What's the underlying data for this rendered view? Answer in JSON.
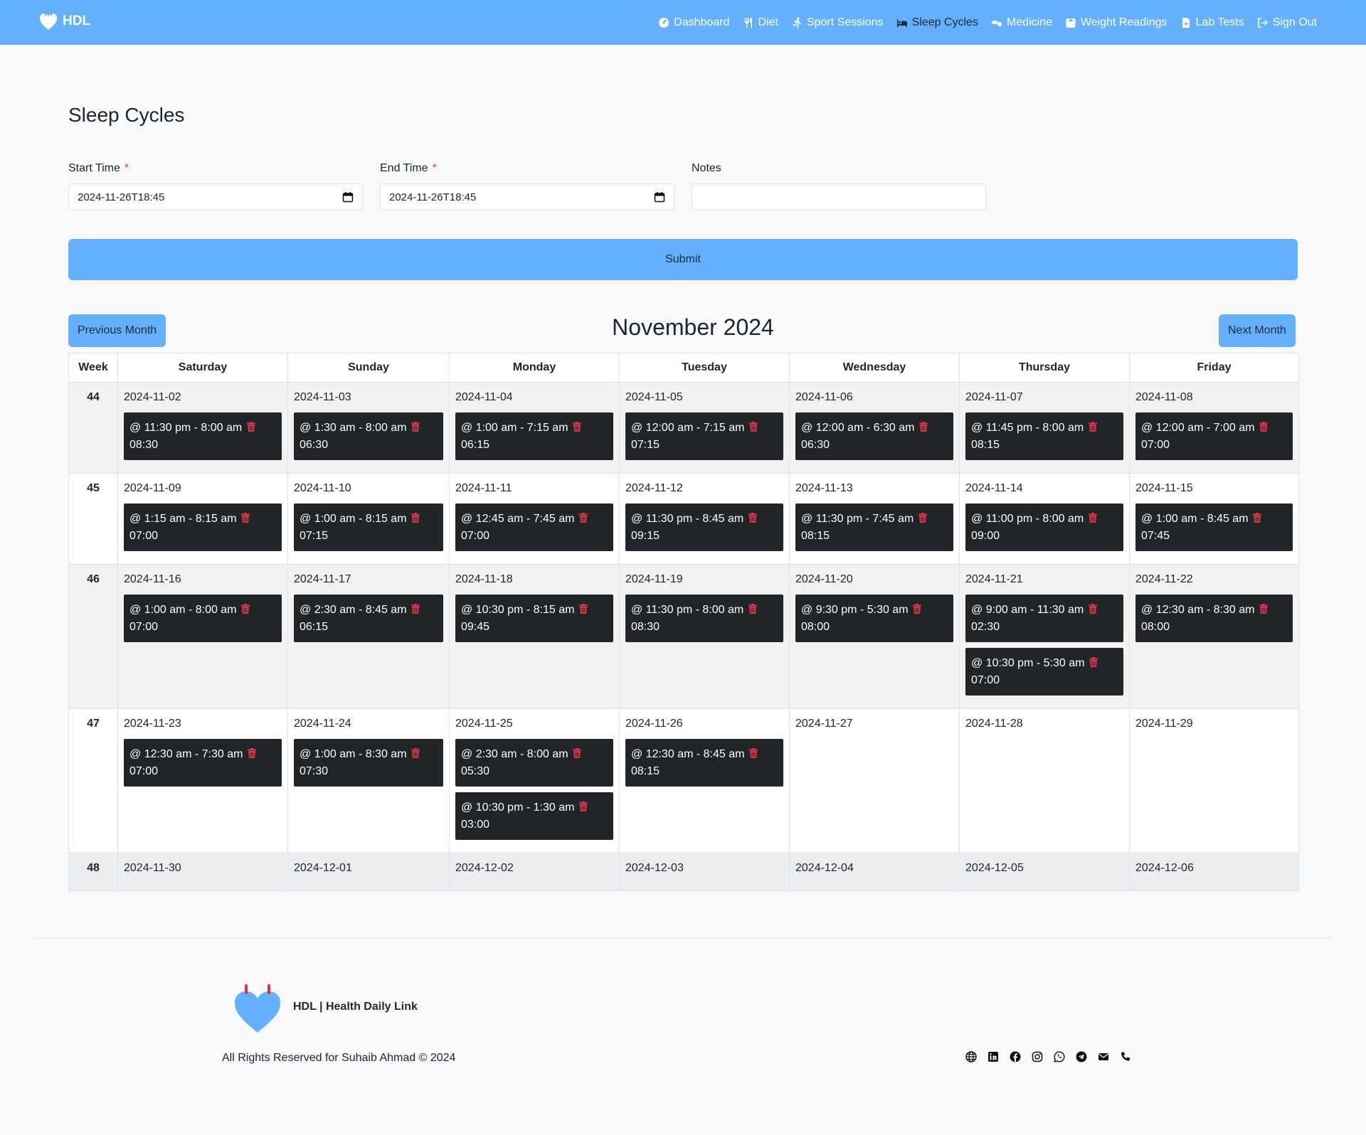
{
  "brand": {
    "name": "HDL"
  },
  "nav": [
    {
      "label": "Dashboard",
      "icon": "dashboard-icon",
      "active": false
    },
    {
      "label": "Diet",
      "icon": "utensils-icon",
      "active": false
    },
    {
      "label": "Sport Sessions",
      "icon": "running-icon",
      "active": false
    },
    {
      "label": "Sleep Cycles",
      "icon": "bed-icon",
      "active": true
    },
    {
      "label": "Medicine",
      "icon": "pills-icon",
      "active": false
    },
    {
      "label": "Weight Readings",
      "icon": "weight-icon",
      "active": false
    },
    {
      "label": "Lab Tests",
      "icon": "file-medical-icon",
      "active": false
    },
    {
      "label": "Sign Out",
      "icon": "sign-out-icon",
      "active": false
    }
  ],
  "page": {
    "title": "Sleep Cycles"
  },
  "form": {
    "start_label": "Start Time",
    "start_value": "2024-11-26T18:45",
    "end_label": "End Time",
    "end_value": "2024-11-26T18:45",
    "notes_label": "Notes",
    "notes_value": "",
    "required_mark": "*",
    "submit_label": "Submit"
  },
  "calendar": {
    "title": "November 2024",
    "prev_label": "Previous Month",
    "next_label": "Next Month",
    "headers": [
      "Week",
      "Saturday",
      "Sunday",
      "Monday",
      "Tuesday",
      "Wednesday",
      "Thursday",
      "Friday"
    ],
    "weeks": [
      {
        "week": "44",
        "days": [
          {
            "date": "2024-11-02",
            "events": [
              {
                "time": "@ 11:30 pm - 8:00 am",
                "duration": "08:30"
              }
            ]
          },
          {
            "date": "2024-11-03",
            "events": [
              {
                "time": "@ 1:30 am - 8:00 am",
                "duration": "06:30"
              }
            ]
          },
          {
            "date": "2024-11-04",
            "events": [
              {
                "time": "@ 1:00 am - 7:15 am",
                "duration": "06:15"
              }
            ]
          },
          {
            "date": "2024-11-05",
            "events": [
              {
                "time": "@ 12:00 am - 7:15 am",
                "duration": "07:15"
              }
            ]
          },
          {
            "date": "2024-11-06",
            "events": [
              {
                "time": "@ 12:00 am - 6:30 am",
                "duration": "06:30"
              }
            ]
          },
          {
            "date": "2024-11-07",
            "events": [
              {
                "time": "@ 11:45 pm - 8:00 am",
                "duration": "08:15"
              }
            ]
          },
          {
            "date": "2024-11-08",
            "events": [
              {
                "time": "@ 12:00 am - 7:00 am",
                "duration": "07:00"
              }
            ]
          }
        ]
      },
      {
        "week": "45",
        "days": [
          {
            "date": "2024-11-09",
            "events": [
              {
                "time": "@ 1:15 am - 8:15 am",
                "duration": "07:00"
              }
            ]
          },
          {
            "date": "2024-11-10",
            "events": [
              {
                "time": "@ 1:00 am - 8:15 am",
                "duration": "07:15"
              }
            ]
          },
          {
            "date": "2024-11-11",
            "events": [
              {
                "time": "@ 12:45 am - 7:45 am",
                "duration": "07:00"
              }
            ]
          },
          {
            "date": "2024-11-12",
            "events": [
              {
                "time": "@ 11:30 pm - 8:45 am",
                "duration": "09:15"
              }
            ]
          },
          {
            "date": "2024-11-13",
            "events": [
              {
                "time": "@ 11:30 pm - 7:45 am",
                "duration": "08:15"
              }
            ]
          },
          {
            "date": "2024-11-14",
            "events": [
              {
                "time": "@ 11:00 pm - 8:00 am",
                "duration": "09:00"
              }
            ]
          },
          {
            "date": "2024-11-15",
            "events": [
              {
                "time": "@ 1:00 am - 8:45 am",
                "duration": "07:45"
              }
            ]
          }
        ]
      },
      {
        "week": "46",
        "days": [
          {
            "date": "2024-11-16",
            "events": [
              {
                "time": "@ 1:00 am - 8:00 am",
                "duration": "07:00"
              }
            ]
          },
          {
            "date": "2024-11-17",
            "events": [
              {
                "time": "@ 2:30 am - 8:45 am",
                "duration": "06:15"
              }
            ]
          },
          {
            "date": "2024-11-18",
            "events": [
              {
                "time": "@ 10:30 pm - 8:15 am",
                "duration": "09:45"
              }
            ]
          },
          {
            "date": "2024-11-19",
            "events": [
              {
                "time": "@ 11:30 pm - 8:00 am",
                "duration": "08:30"
              }
            ]
          },
          {
            "date": "2024-11-20",
            "events": [
              {
                "time": "@ 9:30 pm - 5:30 am",
                "duration": "08:00"
              }
            ]
          },
          {
            "date": "2024-11-21",
            "events": [
              {
                "time": "@ 9:00 am - 11:30 am",
                "duration": "02:30"
              },
              {
                "time": "@ 10:30 pm - 5:30 am",
                "duration": "07:00"
              }
            ]
          },
          {
            "date": "2024-11-22",
            "events": [
              {
                "time": "@ 12:30 am - 8:30 am",
                "duration": "08:00"
              }
            ]
          }
        ]
      },
      {
        "week": "47",
        "days": [
          {
            "date": "2024-11-23",
            "events": [
              {
                "time": "@ 12:30 am - 7:30 am",
                "duration": "07:00"
              }
            ]
          },
          {
            "date": "2024-11-24",
            "events": [
              {
                "time": "@ 1:00 am - 8:30 am",
                "duration": "07:30"
              }
            ]
          },
          {
            "date": "2024-11-25",
            "events": [
              {
                "time": "@ 2:30 am - 8:00 am",
                "duration": "05:30"
              },
              {
                "time": "@ 10:30 pm - 1:30 am",
                "duration": "03:00"
              }
            ]
          },
          {
            "date": "2024-11-26",
            "events": [
              {
                "time": "@ 12:30 am - 8:45 am",
                "duration": "08:15"
              }
            ]
          },
          {
            "date": "2024-11-27",
            "events": []
          },
          {
            "date": "2024-11-28",
            "events": []
          },
          {
            "date": "2024-11-29",
            "events": []
          }
        ]
      },
      {
        "week": "48",
        "days": [
          {
            "date": "2024-11-30",
            "events": []
          },
          {
            "date": "2024-12-01",
            "events": []
          },
          {
            "date": "2024-12-02",
            "events": []
          },
          {
            "date": "2024-12-03",
            "events": []
          },
          {
            "date": "2024-12-04",
            "events": []
          },
          {
            "date": "2024-12-05",
            "events": []
          },
          {
            "date": "2024-12-06",
            "events": []
          }
        ]
      }
    ]
  },
  "footer": {
    "name": "HDL | Health Daily Link",
    "copyright": "All Rights Reserved for Suhaib Ahmad © 2024",
    "socials": [
      "globe-icon",
      "linkedin-icon",
      "facebook-icon",
      "instagram-icon",
      "whatsapp-icon",
      "telegram-icon",
      "envelope-icon",
      "phone-icon"
    ]
  },
  "colors": {
    "accent": "#64b0fd",
    "event_bg": "#212529",
    "trash": "#dc3545"
  }
}
